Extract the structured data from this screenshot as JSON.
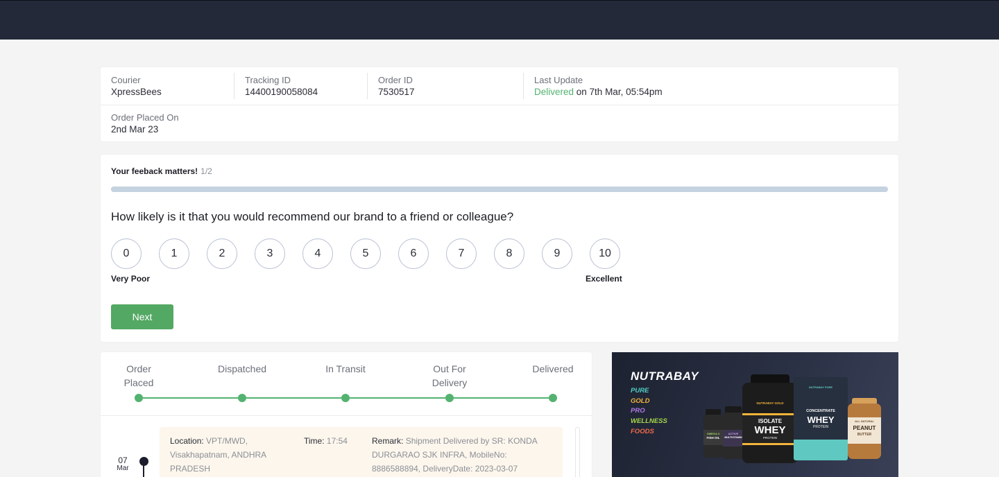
{
  "info": {
    "courier_label": "Courier",
    "courier_value": "XpressBees",
    "tracking_label": "Tracking ID",
    "tracking_value": "14400190058084",
    "order_label": "Order ID",
    "order_value": "7530517",
    "update_label": "Last Update",
    "update_status": "Delivered",
    "update_rest": " on 7th Mar, 05:54pm",
    "placed_label": "Order Placed On",
    "placed_value": "2nd Mar 23"
  },
  "feedback": {
    "heading": "Your feeback matters!",
    "count": "1/2",
    "progress_fraction": 0.5,
    "question": "How likely is it that you would recommend our brand to a friend or colleague?",
    "scores": [
      "0",
      "1",
      "2",
      "3",
      "4",
      "5",
      "6",
      "7",
      "8",
      "9",
      "10"
    ],
    "low_label": "Very Poor",
    "high_label": "Excellent",
    "next_label": "Next"
  },
  "tracking": {
    "steps": [
      {
        "line1": "Order",
        "line2": "Placed"
      },
      {
        "line1": "Dispatched",
        "line2": ""
      },
      {
        "line1": "In Transit",
        "line2": ""
      },
      {
        "line1": "Out For",
        "line2": "Delivery"
      },
      {
        "line1": "Delivered",
        "line2": ""
      }
    ],
    "event": {
      "day": "07",
      "month": "Mar",
      "location_label": "Location:",
      "location_line1": "VPT/MWD,",
      "location_line2": "Visakhapatnam, ANDHRA",
      "location_line3": "PRADESH",
      "time_label": "Time:",
      "time_value": "17:54",
      "remark_label": "Remark:",
      "remark_line1": "Shipment Delivered by SR: KONDA",
      "remark_line2": "DURGARAO SJK INFRA, MobileNo:",
      "remark_line3": "8886588894, DeliveryDate: 2023-03-07"
    }
  },
  "banner": {
    "brand": "NUTRABAY",
    "categories": [
      {
        "name": "PURE",
        "color": "#4fd1c5"
      },
      {
        "name": "GOLD",
        "color": "#f2b43a"
      },
      {
        "name": "PRO",
        "color": "#b07ae8"
      },
      {
        "name": "WELLNESS",
        "color": "#a6d84a"
      },
      {
        "name": "FOODS",
        "color": "#f06a4a"
      }
    ],
    "products": {
      "fish_oil_line1": "OMEGA 3",
      "fish_oil_line2": "FISH OIL",
      "multi_line1": "ACTIVE",
      "multi_line2": "MULTIVITAMIN",
      "isolate_top": "ISOLATE",
      "isolate_main": "WHEY",
      "isolate_sub": "PROTEIN",
      "isolate_brand": "NUTRABAY GOLD",
      "conc_brand": "NUTRABAY PURE",
      "conc_top": "CONCENTRATE",
      "conc_main": "WHEY",
      "conc_sub": "PROTEIN",
      "pb_top": "ALL NATURAL",
      "pb_main": "PEANUT",
      "pb_sub": "BUTTER"
    }
  }
}
